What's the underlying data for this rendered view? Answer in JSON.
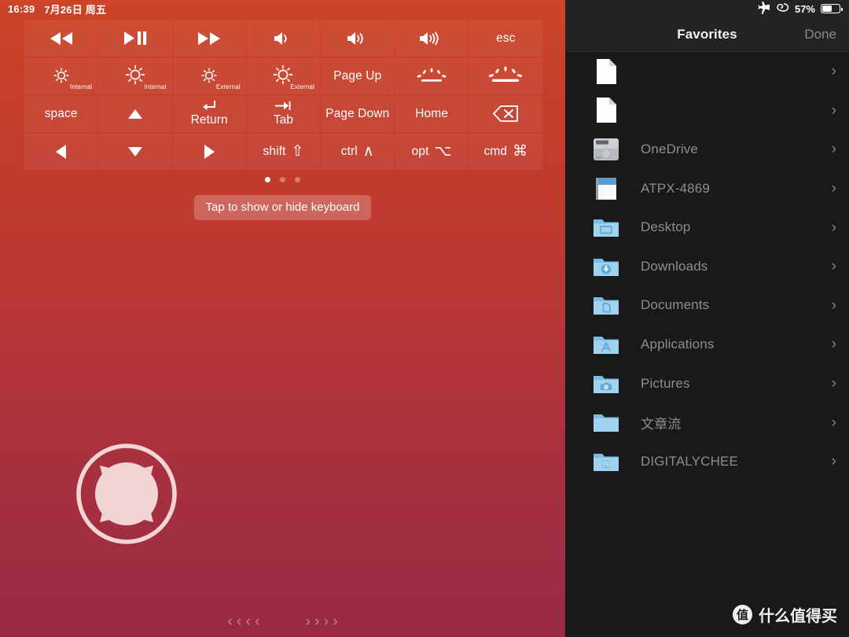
{
  "left_panel": {
    "status": {
      "time": "16:39",
      "date": "7月26日 周五"
    },
    "keys": [
      {
        "name": "rewind",
        "icon": "rewind-icon",
        "label": ""
      },
      {
        "name": "play-pause",
        "icon": "play-pause-icon",
        "label": ""
      },
      {
        "name": "fast-forward",
        "icon": "fast-forward-icon",
        "label": ""
      },
      {
        "name": "volume-mute",
        "icon": "volume-low-icon",
        "label": ""
      },
      {
        "name": "volume-down",
        "icon": "volume-medium-icon",
        "label": ""
      },
      {
        "name": "volume-up",
        "icon": "volume-high-icon",
        "label": ""
      },
      {
        "name": "esc",
        "icon": "",
        "label": "esc"
      },
      {
        "name": "brightness-down-internal",
        "icon": "brightness-low-icon",
        "label": "",
        "sub": "Internal"
      },
      {
        "name": "brightness-up-internal",
        "icon": "brightness-high-icon",
        "label": "",
        "sub": "Internal"
      },
      {
        "name": "brightness-down-external",
        "icon": "brightness-low-icon",
        "label": "",
        "sub": "External"
      },
      {
        "name": "brightness-up-external",
        "icon": "brightness-high-icon",
        "label": "",
        "sub": "External"
      },
      {
        "name": "page-up",
        "icon": "",
        "label": "Page Up"
      },
      {
        "name": "keyboard-backlight-down",
        "icon": "keyboard-backlight-low-icon",
        "label": ""
      },
      {
        "name": "keyboard-backlight-up",
        "icon": "keyboard-backlight-high-icon",
        "label": ""
      },
      {
        "name": "space",
        "icon": "",
        "label": "space"
      },
      {
        "name": "arrow-up",
        "icon": "triangle-up-icon",
        "label": ""
      },
      {
        "name": "return",
        "icon": "return-arrow-icon",
        "label": "Return"
      },
      {
        "name": "tab",
        "icon": "tab-arrow-icon",
        "label": "Tab"
      },
      {
        "name": "page-down",
        "icon": "",
        "label": "Page Down"
      },
      {
        "name": "home",
        "icon": "",
        "label": "Home"
      },
      {
        "name": "delete",
        "icon": "delete-backspace-icon",
        "label": ""
      },
      {
        "name": "arrow-left",
        "icon": "triangle-left-icon",
        "label": ""
      },
      {
        "name": "arrow-down",
        "icon": "triangle-down-icon",
        "label": ""
      },
      {
        "name": "arrow-right",
        "icon": "triangle-right-icon",
        "label": ""
      },
      {
        "name": "shift",
        "icon": "shift-symbol",
        "label": "shift",
        "modifier": "⇧"
      },
      {
        "name": "control",
        "icon": "control-symbol",
        "label": "ctrl",
        "modifier": "∧"
      },
      {
        "name": "option",
        "icon": "option-symbol",
        "label": "opt",
        "modifier": "⌥"
      },
      {
        "name": "command",
        "icon": "command-symbol",
        "label": "cmd",
        "modifier": "⌘"
      }
    ],
    "pager": {
      "count": 3,
      "active_index": 0
    },
    "hint": "Tap to show or hide keyboard",
    "chevrons": {
      "left": "‹ ‹ ‹ ‹",
      "right": "› › › ›"
    }
  },
  "right_panel": {
    "status": {
      "airplane_icon": "airplane-icon",
      "link_icon": "link-loop-icon",
      "battery_percent": "57%",
      "battery_level": 57
    },
    "navbar": {
      "title": "Favorites",
      "done_label": "Done"
    },
    "files": [
      {
        "name": "",
        "icon": "document-icon",
        "chevron": "›"
      },
      {
        "name": "",
        "icon": "document-icon",
        "chevron": "›"
      },
      {
        "name": "OneDrive",
        "icon": "hard-drive-icon",
        "chevron": "›"
      },
      {
        "name": "ATPX-4869",
        "icon": "sd-card-drive-icon",
        "chevron": "›"
      },
      {
        "name": "Desktop",
        "icon": "folder-desktop-icon",
        "chevron": "›"
      },
      {
        "name": "Downloads",
        "icon": "folder-downloads-icon",
        "chevron": "›"
      },
      {
        "name": "Documents",
        "icon": "folder-documents-icon",
        "chevron": "›"
      },
      {
        "name": "Applications",
        "icon": "folder-applications-icon",
        "chevron": "›"
      },
      {
        "name": "Pictures",
        "icon": "folder-pictures-icon",
        "chevron": "›"
      },
      {
        "name": "文章流",
        "icon": "folder-plain-icon",
        "chevron": "›"
      },
      {
        "name": "DIGITALYCHEE",
        "icon": "folder-company-icon",
        "chevron": "›"
      }
    ],
    "watermark": {
      "logo_text": "值",
      "text": "什么值得买"
    }
  },
  "colors": {
    "gradient_top": "#CD4427",
    "gradient_bottom": "#98293F",
    "sidebar_bg": "#191919",
    "folder_blue": "#8CC6E8"
  }
}
